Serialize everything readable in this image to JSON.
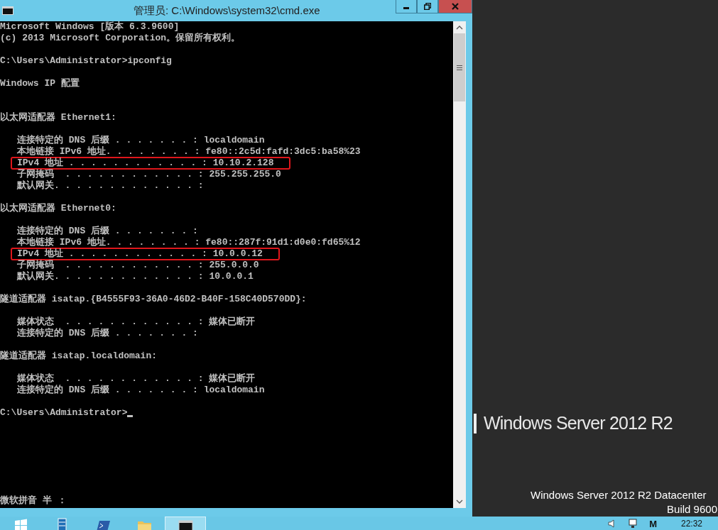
{
  "window": {
    "title": "管理员: C:\\Windows\\system32\\cmd.exe"
  },
  "console": {
    "lines": [
      {
        "kind": "text",
        "text": "Microsoft Windows [版本 6.3.9600]"
      },
      {
        "kind": "text",
        "text": "(c) 2013 Microsoft Corporation。保留所有权利。"
      },
      {
        "kind": "blank"
      },
      {
        "kind": "text",
        "text": "C:\\Users\\Administrator>ipconfig"
      },
      {
        "kind": "blank"
      },
      {
        "kind": "text",
        "text": "Windows IP 配置"
      },
      {
        "kind": "blank"
      },
      {
        "kind": "blank"
      },
      {
        "kind": "text",
        "text": "以太网适配器 Ethernet1:"
      },
      {
        "kind": "blank"
      },
      {
        "kind": "entry",
        "text": "连接特定的 DNS 后缀 . . . . . . . : localdomain",
        "highlighted": false
      },
      {
        "kind": "entry",
        "text": "本地链接 IPv6 地址. . . . . . . . : fe80::2c5d:fafd:3dc5:ba58%23",
        "highlighted": false
      },
      {
        "kind": "entry",
        "text": "IPv4 地址 . . . . . . . . . . . . : 10.10.2.128",
        "highlighted": true
      },
      {
        "kind": "entry",
        "text": "子网掩码  . . . . . . . . . . . . : 255.255.255.0",
        "highlighted": false
      },
      {
        "kind": "entry",
        "text": "默认网关. . . . . . . . . . . . . :",
        "highlighted": false
      },
      {
        "kind": "blank"
      },
      {
        "kind": "text",
        "text": "以太网适配器 Ethernet0:"
      },
      {
        "kind": "blank"
      },
      {
        "kind": "entry",
        "text": "连接特定的 DNS 后缀 . . . . . . . :",
        "highlighted": false
      },
      {
        "kind": "entry",
        "text": "本地链接 IPv6 地址. . . . . . . . : fe80::287f:91d1:d0e0:fd65%12",
        "highlighted": false
      },
      {
        "kind": "entry",
        "text": "IPv4 地址 . . . . . . . . . . . . : 10.0.0.12",
        "highlighted": true
      },
      {
        "kind": "entry",
        "text": "子网掩码  . . . . . . . . . . . . : 255.0.0.0",
        "highlighted": false
      },
      {
        "kind": "entry",
        "text": "默认网关. . . . . . . . . . . . . : 10.0.0.1",
        "highlighted": false
      },
      {
        "kind": "blank"
      },
      {
        "kind": "text",
        "text": "隧道适配器 isatap.{B4555F93-36A0-46D2-B40F-158C40D570DD}:"
      },
      {
        "kind": "blank"
      },
      {
        "kind": "entry",
        "text": "媒体状态  . . . . . . . . . . . . : 媒体已断开",
        "highlighted": false
      },
      {
        "kind": "entry",
        "text": "连接特定的 DNS 后缀 . . . . . . . :",
        "highlighted": false
      },
      {
        "kind": "blank"
      },
      {
        "kind": "text",
        "text": "隧道适配器 isatap.localdomain:"
      },
      {
        "kind": "blank"
      },
      {
        "kind": "entry",
        "text": "媒体状态  . . . . . . . . . . . . : 媒体已断开",
        "highlighted": false
      },
      {
        "kind": "entry",
        "text": "连接特定的 DNS 后缀 . . . . . . . : localdomain",
        "highlighted": false
      },
      {
        "kind": "blank"
      },
      {
        "kind": "prompt",
        "text": "C:\\Users\\Administrator>",
        "cursor": true
      }
    ],
    "ime_status": "微软拼音 半 ："
  },
  "desktop": {
    "brand": "Windows Server 2012 R2",
    "edition": "Windows Server 2012 R2 Datacenter",
    "build": "Build 9600"
  },
  "taskbar": {
    "apps": [
      {
        "kind": "start",
        "selected": false
      },
      {
        "kind": "server",
        "selected": false
      },
      {
        "kind": "powershell",
        "selected": false
      },
      {
        "kind": "folder",
        "selected": false
      },
      {
        "kind": "console",
        "selected": true
      }
    ],
    "input_indicator": "M",
    "clock": "22:32"
  }
}
